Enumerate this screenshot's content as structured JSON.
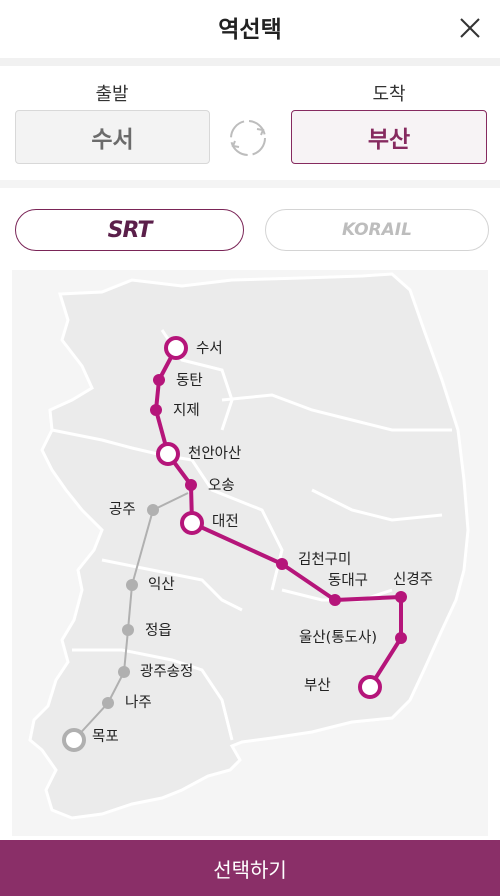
{
  "header": {
    "title": "역선택"
  },
  "route": {
    "departure_label": "출발",
    "arrival_label": "도착",
    "departure_station": "수서",
    "arrival_station": "부산"
  },
  "operators": [
    {
      "name": "SRT",
      "selected": true
    },
    {
      "name": "KORAIL",
      "selected": false
    }
  ],
  "map": {
    "srt_stations": [
      "수서",
      "동탄",
      "지제",
      "천안아산",
      "오송",
      "대전",
      "김천구미",
      "동대구",
      "신경주",
      "울산(통도사)",
      "부산"
    ],
    "other_stations": [
      "공주",
      "익산",
      "정읍",
      "광주송정",
      "나주",
      "목포"
    ]
  },
  "footer": {
    "select_label": "선택하기"
  },
  "colors": {
    "accent": "#8a2f68",
    "srt_line": "#b5157a",
    "other_line": "#b0b0b0"
  }
}
